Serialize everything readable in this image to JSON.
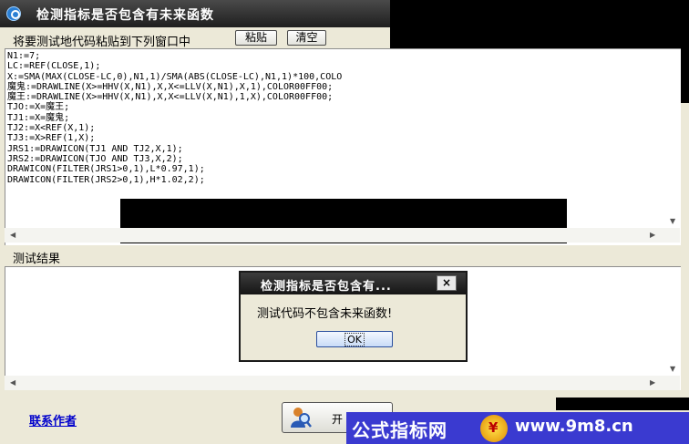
{
  "window": {
    "title": "检测指标是否包含有未来函数"
  },
  "toolbar": {
    "instruction": "将要测试地代码粘贴到下列窗口中",
    "paste_label": "粘贴",
    "clear_label": "清空"
  },
  "editor": {
    "code": "N1:=7;\nLC:=REF(CLOSE,1);\nX:=SMA(MAX(CLOSE-LC,0),N1,1)/SMA(ABS(CLOSE-LC),N1,1)*100,COLO\n魔鬼:=DRAWLINE(X>=HHV(X,N1),X,X<=LLV(X,N1),X,1),COLOR00FF00;\n魔王:=DRAWLINE(X>=HHV(X,N1),X,X<=LLV(X,N1),1,X),COLOR00FF00;\nTJO:=X=魔王;\nTJ1:=X=魔鬼;\nTJ2:=X<REF(X,1);\nTJ3:=X>REF(1,X);\nJRS1:=DRAWICON(TJ1 AND TJ2,X,1);\nJRS2:=DRAWICON(TJO AND TJ3,X,2);\nDRAWICON(FILTER(JRS1>0,1),L*0.97,1);\nDRAWICON(FILTER(JRS2>0,1),H*1.02,2);"
  },
  "results": {
    "label": "测试结果"
  },
  "footer": {
    "contact_label": "联系作者",
    "start_label": "开"
  },
  "dialog": {
    "title": "检测指标是否包含有...",
    "close_label": "×",
    "message": "测试代码不包含未来函数!",
    "ok_label": "OK"
  },
  "watermark": {
    "left_text": "公式指标网",
    "right_text": "www.9m8.cn"
  }
}
